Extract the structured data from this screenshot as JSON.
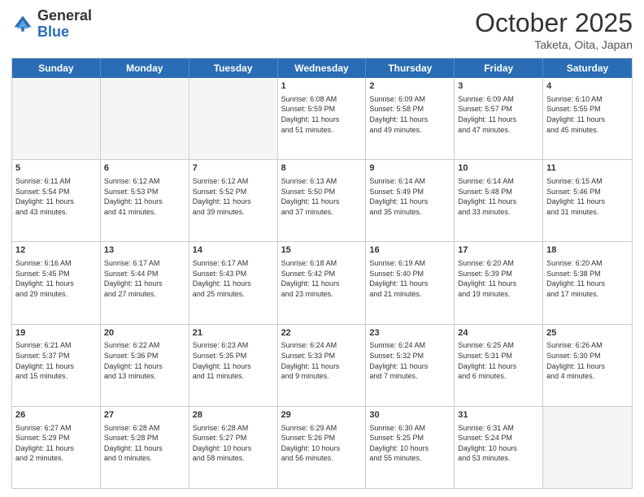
{
  "header": {
    "logo_general": "General",
    "logo_blue": "Blue",
    "month_title": "October 2025",
    "subtitle": "Taketa, Oita, Japan"
  },
  "day_headers": [
    "Sunday",
    "Monday",
    "Tuesday",
    "Wednesday",
    "Thursday",
    "Friday",
    "Saturday"
  ],
  "weeks": [
    [
      {
        "num": "",
        "info": ""
      },
      {
        "num": "",
        "info": ""
      },
      {
        "num": "",
        "info": ""
      },
      {
        "num": "1",
        "info": "Sunrise: 6:08 AM\nSunset: 5:59 PM\nDaylight: 11 hours\nand 51 minutes."
      },
      {
        "num": "2",
        "info": "Sunrise: 6:09 AM\nSunset: 5:58 PM\nDaylight: 11 hours\nand 49 minutes."
      },
      {
        "num": "3",
        "info": "Sunrise: 6:09 AM\nSunset: 5:57 PM\nDaylight: 11 hours\nand 47 minutes."
      },
      {
        "num": "4",
        "info": "Sunrise: 6:10 AM\nSunset: 5:55 PM\nDaylight: 11 hours\nand 45 minutes."
      }
    ],
    [
      {
        "num": "5",
        "info": "Sunrise: 6:11 AM\nSunset: 5:54 PM\nDaylight: 11 hours\nand 43 minutes."
      },
      {
        "num": "6",
        "info": "Sunrise: 6:12 AM\nSunset: 5:53 PM\nDaylight: 11 hours\nand 41 minutes."
      },
      {
        "num": "7",
        "info": "Sunrise: 6:12 AM\nSunset: 5:52 PM\nDaylight: 11 hours\nand 39 minutes."
      },
      {
        "num": "8",
        "info": "Sunrise: 6:13 AM\nSunset: 5:50 PM\nDaylight: 11 hours\nand 37 minutes."
      },
      {
        "num": "9",
        "info": "Sunrise: 6:14 AM\nSunset: 5:49 PM\nDaylight: 11 hours\nand 35 minutes."
      },
      {
        "num": "10",
        "info": "Sunrise: 6:14 AM\nSunset: 5:48 PM\nDaylight: 11 hours\nand 33 minutes."
      },
      {
        "num": "11",
        "info": "Sunrise: 6:15 AM\nSunset: 5:46 PM\nDaylight: 11 hours\nand 31 minutes."
      }
    ],
    [
      {
        "num": "12",
        "info": "Sunrise: 6:16 AM\nSunset: 5:45 PM\nDaylight: 11 hours\nand 29 minutes."
      },
      {
        "num": "13",
        "info": "Sunrise: 6:17 AM\nSunset: 5:44 PM\nDaylight: 11 hours\nand 27 minutes."
      },
      {
        "num": "14",
        "info": "Sunrise: 6:17 AM\nSunset: 5:43 PM\nDaylight: 11 hours\nand 25 minutes."
      },
      {
        "num": "15",
        "info": "Sunrise: 6:18 AM\nSunset: 5:42 PM\nDaylight: 11 hours\nand 23 minutes."
      },
      {
        "num": "16",
        "info": "Sunrise: 6:19 AM\nSunset: 5:40 PM\nDaylight: 11 hours\nand 21 minutes."
      },
      {
        "num": "17",
        "info": "Sunrise: 6:20 AM\nSunset: 5:39 PM\nDaylight: 11 hours\nand 19 minutes."
      },
      {
        "num": "18",
        "info": "Sunrise: 6:20 AM\nSunset: 5:38 PM\nDaylight: 11 hours\nand 17 minutes."
      }
    ],
    [
      {
        "num": "19",
        "info": "Sunrise: 6:21 AM\nSunset: 5:37 PM\nDaylight: 11 hours\nand 15 minutes."
      },
      {
        "num": "20",
        "info": "Sunrise: 6:22 AM\nSunset: 5:36 PM\nDaylight: 11 hours\nand 13 minutes."
      },
      {
        "num": "21",
        "info": "Sunrise: 6:23 AM\nSunset: 5:35 PM\nDaylight: 11 hours\nand 11 minutes."
      },
      {
        "num": "22",
        "info": "Sunrise: 6:24 AM\nSunset: 5:33 PM\nDaylight: 11 hours\nand 9 minutes."
      },
      {
        "num": "23",
        "info": "Sunrise: 6:24 AM\nSunset: 5:32 PM\nDaylight: 11 hours\nand 7 minutes."
      },
      {
        "num": "24",
        "info": "Sunrise: 6:25 AM\nSunset: 5:31 PM\nDaylight: 11 hours\nand 6 minutes."
      },
      {
        "num": "25",
        "info": "Sunrise: 6:26 AM\nSunset: 5:30 PM\nDaylight: 11 hours\nand 4 minutes."
      }
    ],
    [
      {
        "num": "26",
        "info": "Sunrise: 6:27 AM\nSunset: 5:29 PM\nDaylight: 11 hours\nand 2 minutes."
      },
      {
        "num": "27",
        "info": "Sunrise: 6:28 AM\nSunset: 5:28 PM\nDaylight: 11 hours\nand 0 minutes."
      },
      {
        "num": "28",
        "info": "Sunrise: 6:28 AM\nSunset: 5:27 PM\nDaylight: 10 hours\nand 58 minutes."
      },
      {
        "num": "29",
        "info": "Sunrise: 6:29 AM\nSunset: 5:26 PM\nDaylight: 10 hours\nand 56 minutes."
      },
      {
        "num": "30",
        "info": "Sunrise: 6:30 AM\nSunset: 5:25 PM\nDaylight: 10 hours\nand 55 minutes."
      },
      {
        "num": "31",
        "info": "Sunrise: 6:31 AM\nSunset: 5:24 PM\nDaylight: 10 hours\nand 53 minutes."
      },
      {
        "num": "",
        "info": ""
      }
    ]
  ]
}
